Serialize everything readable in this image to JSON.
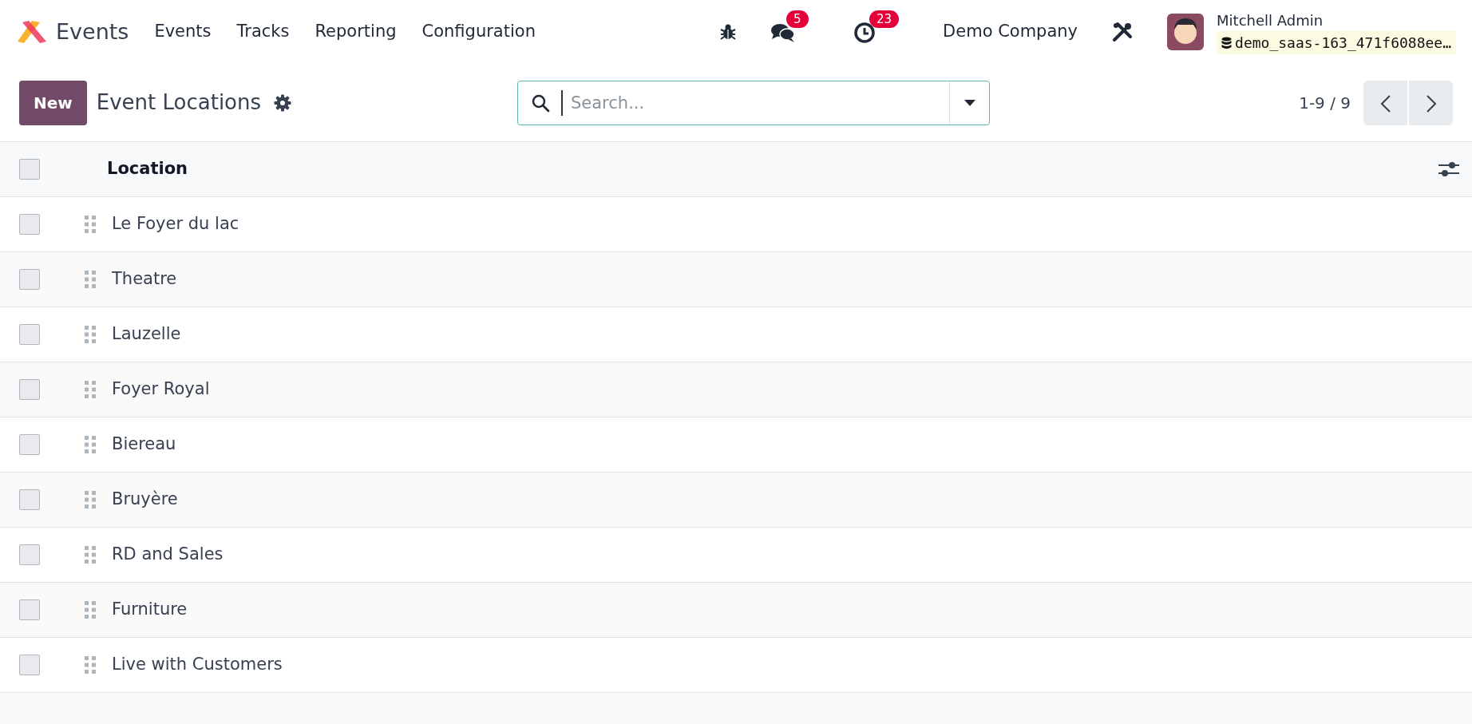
{
  "navbar": {
    "app_name": "Events",
    "menu": [
      "Events",
      "Tracks",
      "Reporting",
      "Configuration"
    ],
    "messages_count": "5",
    "activities_count": "23",
    "company": "Demo Company",
    "user_name": "Mitchell Admin",
    "database": "demo_saas-163_471f6088ee…"
  },
  "control_panel": {
    "new_button": "New",
    "title": "Event Locations",
    "search": {
      "placeholder": "Search..."
    },
    "pager": "1-9 / 9"
  },
  "table": {
    "columns": [
      "Location"
    ],
    "header_checked": false,
    "rows": [
      {
        "location": "Le Foyer du lac",
        "checked": false
      },
      {
        "location": "Theatre",
        "checked": false
      },
      {
        "location": "Lauzelle",
        "checked": false
      },
      {
        "location": "Foyer Royal",
        "checked": false
      },
      {
        "location": "Biereau",
        "checked": false
      },
      {
        "location": "Bruyère",
        "checked": false
      },
      {
        "location": "RD and Sales",
        "checked": false
      },
      {
        "location": "Furniture",
        "checked": false
      },
      {
        "location": "Live with Customers",
        "checked": false
      }
    ]
  }
}
